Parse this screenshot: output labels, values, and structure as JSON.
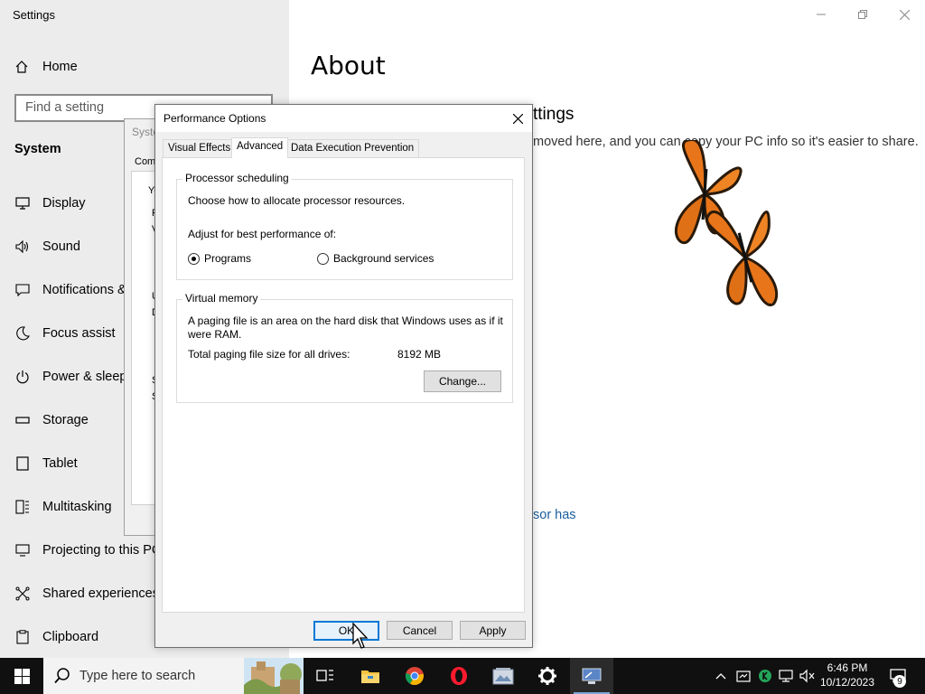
{
  "settings": {
    "window_title": "Settings",
    "home_label": "Home",
    "search_placeholder": "Find a setting",
    "section_label": "System",
    "nav_items": [
      {
        "label": "Display",
        "icon": "display-icon"
      },
      {
        "label": "Sound",
        "icon": "speaker-icon"
      },
      {
        "label": "Notifications &",
        "icon": "notification-icon"
      },
      {
        "label": "Focus assist",
        "icon": "moon-icon"
      },
      {
        "label": "Power & sleep",
        "icon": "power-icon"
      },
      {
        "label": "Storage",
        "icon": "storage-icon"
      },
      {
        "label": "Tablet",
        "icon": "tablet-icon"
      },
      {
        "label": "Multitasking",
        "icon": "multitasking-icon"
      },
      {
        "label": "Projecting to this PC",
        "icon": "projecting-icon"
      },
      {
        "label": "Shared experiences",
        "icon": "shared-icon"
      },
      {
        "label": "Clipboard",
        "icon": "clipboard-icon"
      }
    ],
    "page_title": "About",
    "related_heading": "ttings",
    "related_text": "moved here, and you can copy your PC info so it's easier to share.",
    "link_fragment": "sor has"
  },
  "system_properties": {
    "title": "Syste",
    "tab": "Com",
    "frag_1": "Yo",
    "frag_2": "F",
    "frag_3": "V",
    "frag_4": "U",
    "frag_5": "D",
    "frag_6": "S",
    "frag_7": "S"
  },
  "performance_options": {
    "title": "Performance Options",
    "tabs": [
      "Visual Effects",
      "Advanced",
      "Data Execution Prevention"
    ],
    "active_tab": "Advanced",
    "processor_group": {
      "title": "Processor scheduling",
      "description": "Choose how to allocate processor resources.",
      "adjust_label": "Adjust for best performance of:",
      "options": [
        {
          "label": "Programs",
          "checked": true
        },
        {
          "label": "Background services",
          "checked": false
        }
      ]
    },
    "virtual_memory_group": {
      "title": "Virtual memory",
      "description_line1": "A paging file is an area on the hard disk that Windows uses as if it",
      "description_line2": "were RAM.",
      "total_label": "Total paging file size for all drives:",
      "total_value": "8192 MB",
      "change_button": "Change..."
    },
    "buttons": {
      "ok": "OK",
      "cancel": "Cancel",
      "apply": "Apply"
    }
  },
  "taskbar": {
    "search_placeholder": "Type here to search",
    "time": "6:46 PM",
    "date": "10/12/2023",
    "notification_count": "9"
  },
  "colors": {
    "accent": "#0078d7",
    "link": "#1a5d9e",
    "taskbar": "#101010",
    "sidebar": "#ececec"
  }
}
